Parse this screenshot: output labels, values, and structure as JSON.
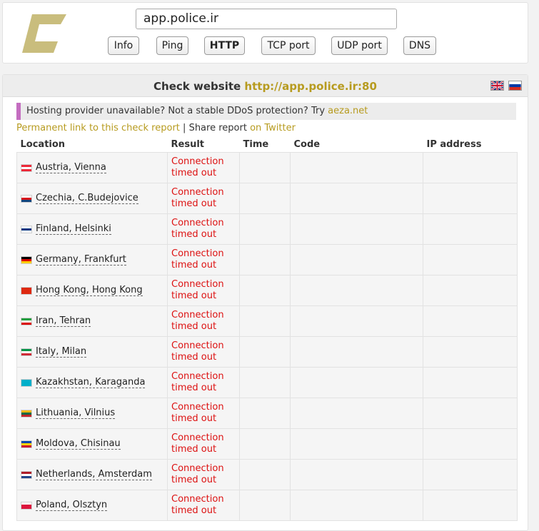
{
  "search": {
    "value": "app.police.ir"
  },
  "buttons": [
    "Info",
    "Ping",
    "HTTP",
    "TCP port",
    "UDP port",
    "DNS"
  ],
  "active_button": "HTTP",
  "heading": {
    "label": "Check website",
    "url": "http://app.police.ir:80"
  },
  "promo": {
    "text": "Hosting provider unavailable? Not a stable DDoS protection? Try",
    "link": "aeza.net"
  },
  "report": {
    "permanent_link": "Permanent link to this check report",
    "separator": "|",
    "share": "Share report",
    "twitter": "on Twitter"
  },
  "table": {
    "headers": [
      "Location",
      "Result",
      "Time",
      "Code",
      "IP address"
    ],
    "rows": [
      {
        "location": "Austria, Vienna",
        "flag": [
          "#ed2939",
          "#ffffff",
          "#ed2939"
        ],
        "result": "Connection\ntimed out"
      },
      {
        "location": "Czechia, C.Budejovice",
        "flag": [
          "#ffffff",
          "#d7141a",
          "#11457e"
        ],
        "result": "Connection\ntimed out"
      },
      {
        "location": "Finland, Helsinki",
        "flag": [
          "#ffffff",
          "#003580",
          "#ffffff"
        ],
        "result": "Connection\ntimed out"
      },
      {
        "location": "Germany, Frankfurt",
        "flag": [
          "#000000",
          "#dd0000",
          "#ffce00"
        ],
        "result": "Connection\ntimed out"
      },
      {
        "location": "Hong Kong, Hong Kong",
        "flag": [
          "#de2910",
          "#de2910",
          "#de2910"
        ],
        "result": "Connection\ntimed out"
      },
      {
        "location": "Iran, Tehran",
        "flag": [
          "#239f40",
          "#ffffff",
          "#da0000"
        ],
        "result": "Connection\ntimed out"
      },
      {
        "location": "Italy, Milan",
        "flag": [
          "#009246",
          "#ffffff",
          "#ce2b37"
        ],
        "result": "Connection\ntimed out"
      },
      {
        "location": "Kazakhstan, Karaganda",
        "flag": [
          "#00afca",
          "#00afca",
          "#00afca"
        ],
        "result": "Connection\ntimed out"
      },
      {
        "location": "Lithuania, Vilnius",
        "flag": [
          "#fdb913",
          "#006a44",
          "#c1272d"
        ],
        "result": "Connection\ntimed out"
      },
      {
        "location": "Moldova, Chisinau",
        "flag": [
          "#0046ae",
          "#ffd200",
          "#cc092f"
        ],
        "result": "Connection\ntimed out"
      },
      {
        "location": "Netherlands, Amsterdam",
        "flag": [
          "#ae1c28",
          "#ffffff",
          "#21468b"
        ],
        "result": "Connection\ntimed out"
      },
      {
        "location": "Poland, Olsztyn",
        "flag": [
          "#ffffff",
          "#dc143c",
          "#dc143c"
        ],
        "result": "Connection\ntimed out"
      }
    ]
  }
}
